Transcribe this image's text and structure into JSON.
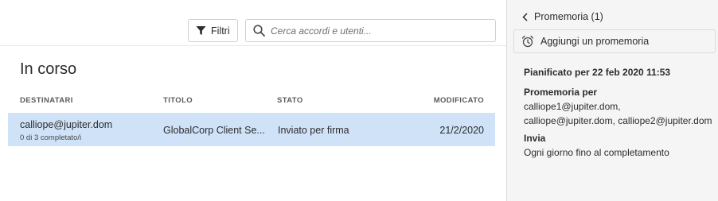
{
  "toolbar": {
    "filter_label": "Filtri",
    "filter_icon": "filter-icon",
    "search_placeholder": "Cerca accordi e utenti...",
    "search_icon": "search-icon"
  },
  "section": {
    "title": "In corso"
  },
  "table": {
    "columns": {
      "recipients": "DESTINATARI",
      "title": "TITOLO",
      "status": "STATO",
      "modified": "MODIFICATO"
    },
    "rows": [
      {
        "recipient": "calliope@jupiter.dom",
        "progress": "0 di 3 completato/i",
        "title": "GlobalCorp Client Se...",
        "status": "Inviato per firma",
        "modified": "21/2/2020"
      }
    ]
  },
  "panel": {
    "back_label": "Promemoria (1)",
    "back_icon": "chevron-left-icon",
    "add_label": "Aggiungi un promemoria",
    "add_icon": "alarm-clock-icon",
    "scheduled": "Pianificato per 22 feb 2020 11:53",
    "reminder_for_label": "Promemoria per",
    "reminder_for_line1": "calliope1@jupiter.dom,",
    "reminder_for_line2": "calliope@jupiter.dom, calliope2@jupiter.dom",
    "send_label": "Invia",
    "send_value": "Ogni giorno fino al completamento"
  },
  "colors": {
    "selected_row": "#cfe2f8",
    "panel_bg": "#f5f5f5"
  }
}
